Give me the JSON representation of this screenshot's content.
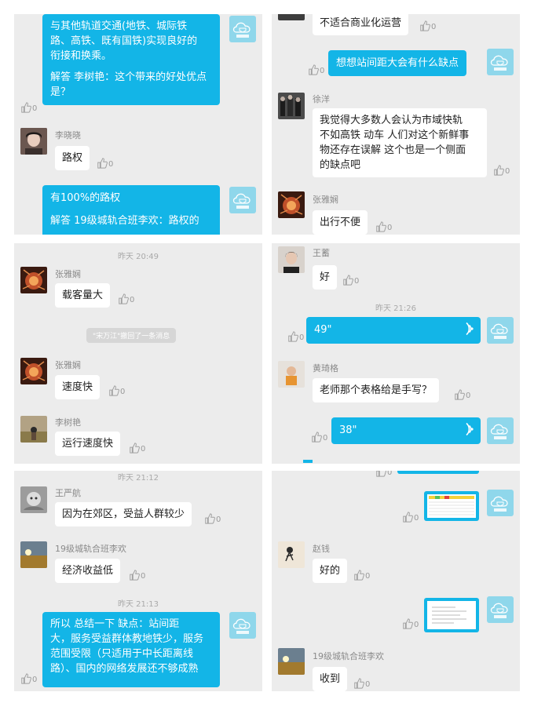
{
  "panel1": {
    "msg1": [
      "与其他轨道交通(地铁、城际铁",
      "路、高铁、既有国铁)实现良好的",
      "衔接和换乘。"
    ],
    "msg1b": [
      "解答 李树艳：这个带来的好处优点",
      "是？"
    ],
    "user1": "李晓晓",
    "reply1": "路权",
    "msg2a": "有100%的路权",
    "msg2b": "解答 19级城轨合班李欢：路权的",
    "likes": "0"
  },
  "panel2": {
    "reply0": "不适合商业化运营",
    "out1": "想想站间距大会有什么缺点",
    "user1": "徐洋",
    "reply1": [
      "我觉得大多数人会认为市域快轨",
      "不如高铁 动车 人们对这个新鲜事",
      "物还存在误解 这个也是一个侧面",
      "的缺点吧"
    ],
    "user2": "张雅娴",
    "reply2": "出行不便",
    "likes": "0"
  },
  "panel3": {
    "time1": "昨天 20:49",
    "user1": "张雅娴",
    "reply1": "载客量大",
    "sys": "\"宋万江\"撤回了一条消息",
    "user2": "张雅娴",
    "reply2": "速度快",
    "user3": "李树艳",
    "reply3": "运行速度快",
    "likes": "0"
  },
  "panel4": {
    "user1": "王蓄",
    "reply1": "好",
    "time1": "昨天 21:26",
    "voice1": "49\"",
    "user2": "黄琦格",
    "reply2": "老师那个表格给是手写？",
    "voice2": "38\"",
    "likes": "0"
  },
  "panel5": {
    "time1": "昨天 21:12",
    "user1": "王严航",
    "reply1": "因为在郊区，受益人群较少",
    "user2": "19级城轨合班李欢",
    "reply2": "经济收益低",
    "time2": "昨天 21:13",
    "out1": [
      "所以 总结一下  缺点：站间距",
      "大，服务受益群体教地铁少，服务",
      "范围受限（只适用于中长距离线",
      "路）、国内的网络发展还不够成熟"
    ],
    "likes": "0"
  },
  "panel6": {
    "user1": "赵钱",
    "reply1": "好的",
    "user2": "19级城轨合班李欢",
    "reply2": "收到",
    "likes": "0"
  },
  "colors": {
    "accent": "#13b5e7",
    "panel_bg": "#ececec"
  }
}
